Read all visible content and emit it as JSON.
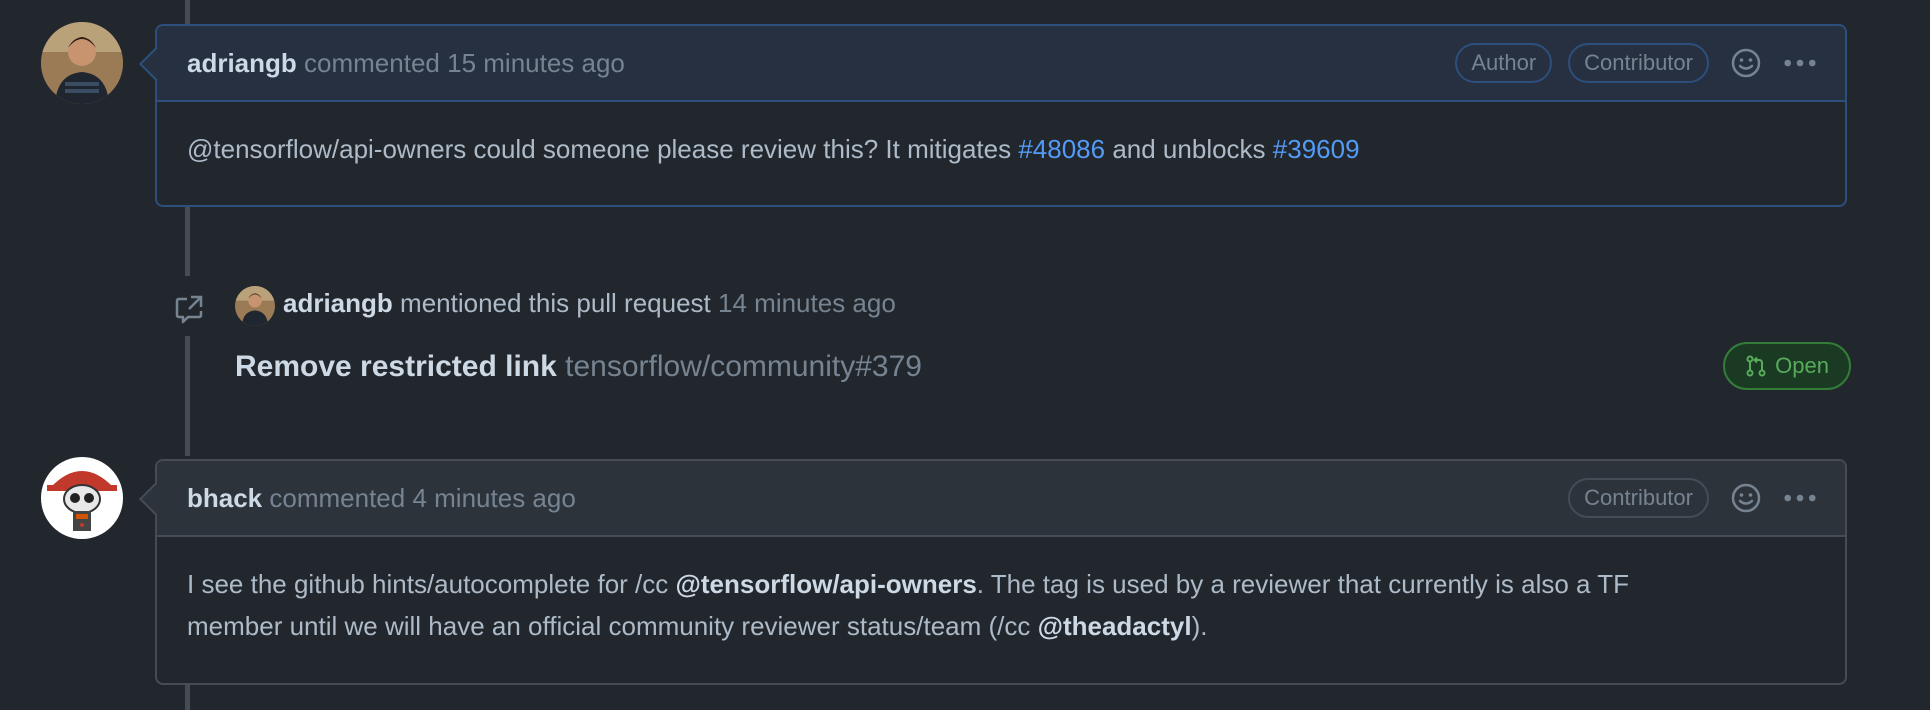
{
  "comments": [
    {
      "author": "adriangb",
      "verb": "commented",
      "time": "15 minutes ago",
      "badges": [
        "Author",
        "Contributor"
      ],
      "body": {
        "prefix": "@tensorflow/api-owners could someone please review this? It mitigates ",
        "link1": "#48086",
        "middle": " and unblocks ",
        "link2": "#39609"
      }
    },
    {
      "author": "bhack",
      "verb": "commented",
      "time": "4 minutes ago",
      "badges": [
        "Contributor"
      ],
      "body": {
        "part1": "I see the github hints/autocomplete for /cc ",
        "mention1": "@tensorflow/api-owners",
        "part2": ". The tag is used by a reviewer that currently is also a TF",
        "part3": "member until we will have an official community reviewer status/team (/cc ",
        "mention2": "@theadactyl",
        "part4": ")."
      }
    }
  ],
  "mention_event": {
    "actor": "adriangb",
    "action": "mentioned this pull request",
    "time": "14 minutes ago",
    "pr_title": "Remove restricted link",
    "pr_ref": "tensorflow/community#379",
    "state": "Open"
  },
  "icons": {
    "reaction": "smiley-icon",
    "more": "kebab-horizontal-icon",
    "cross_reference": "cross-reference-icon",
    "pr_open": "git-pull-request-icon"
  },
  "colors": {
    "background": "#22272e",
    "link": "#539bf5",
    "open_green": "#57ab5a",
    "author_border": "#2c4f7c"
  }
}
